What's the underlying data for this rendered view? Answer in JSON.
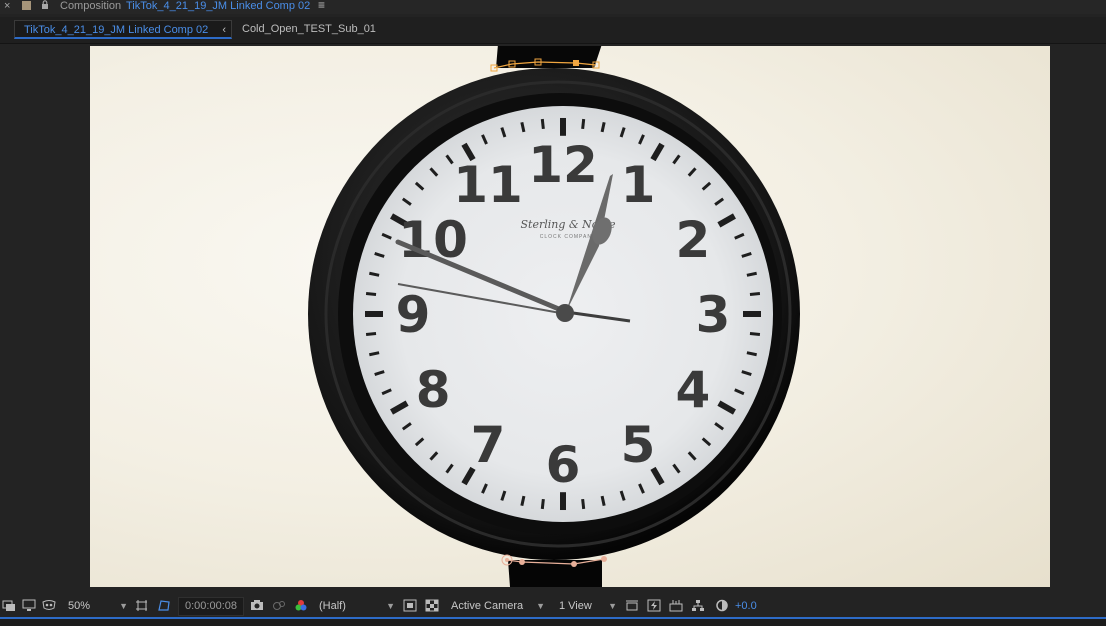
{
  "titlebar": {
    "close_label": "×",
    "panel_label": "Composition",
    "comp_name": "TikTok_4_21_19_JM Linked Comp 02",
    "menu_label": "≡"
  },
  "tabs": [
    {
      "label": "TikTok_4_21_19_JM Linked Comp 02",
      "active": true
    },
    {
      "label": "Cold_Open_TEST_Sub_01",
      "active": false
    }
  ],
  "tab_chevron": "‹",
  "viewer": {
    "clock_numerals": [
      "12",
      "1",
      "2",
      "3",
      "4",
      "5",
      "6",
      "7",
      "8",
      "9",
      "10",
      "11"
    ],
    "clock_brand": "Sterling & Noble",
    "clock_sub": "CLOCK COMPANY"
  },
  "toolbar": {
    "magnification": "50%",
    "timecode": "0:00:00:08",
    "resolution": "(Half)",
    "camera": "Active Camera",
    "views": "1 View",
    "exposure": "+0.0"
  },
  "colors": {
    "accent": "#4a8ee8",
    "mask_path": "#f0a640",
    "panel_bg": "#232323"
  }
}
